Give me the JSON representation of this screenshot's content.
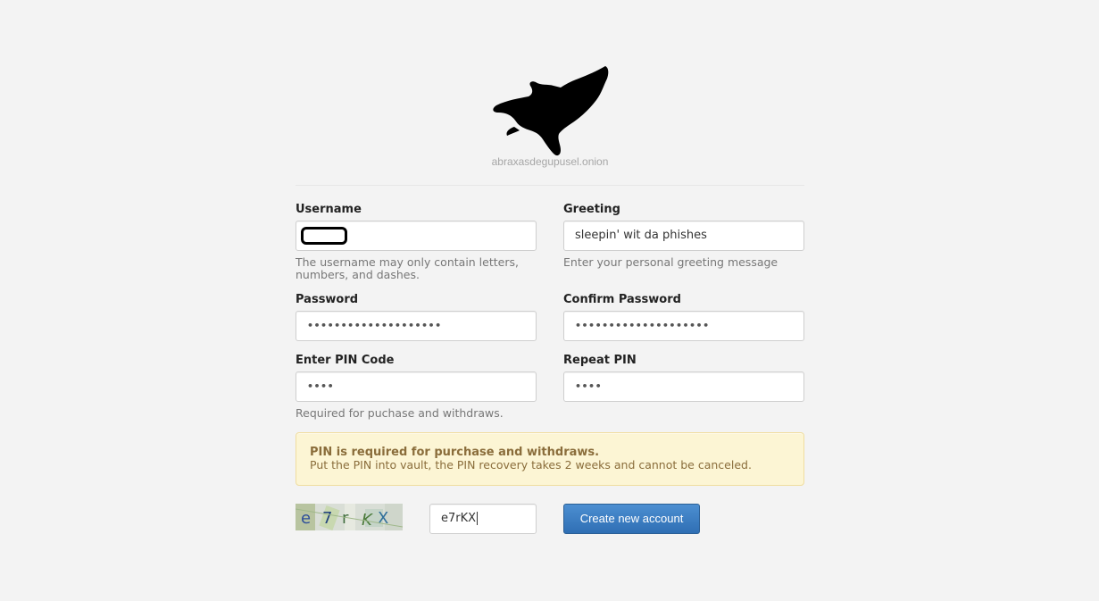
{
  "header": {
    "site_name": "abraxasdegupusel.onion",
    "logo_icon": "eagle-icon"
  },
  "form": {
    "username": {
      "label": "Username",
      "value": "",
      "help": "The username may only contain letters, numbers, and dashes."
    },
    "greeting": {
      "label": "Greeting",
      "value": "sleepin' wit da phishes",
      "help": "Enter your personal greeting message"
    },
    "password": {
      "label": "Password",
      "value": "••••••••••••••••••••"
    },
    "confirm_password": {
      "label": "Confirm Password",
      "value": "••••••••••••••••••••"
    },
    "pin": {
      "label": "Enter PIN Code",
      "value": "••••",
      "help": "Required for puchase and withdraws."
    },
    "repeat_pin": {
      "label": "Repeat PIN",
      "value": "••••"
    }
  },
  "alert": {
    "title": "PIN is required for purchase and withdraws.",
    "body": "Put the PIN into vault, the PIN recovery takes 2 weeks and cannot be canceled."
  },
  "captcha": {
    "image_text": "e7rKX",
    "input_value": "e7rKX"
  },
  "submit": {
    "label": "Create new account"
  },
  "colors": {
    "background": "#f3f3f3",
    "primary_button": "#3a7bc2",
    "alert_background": "#fcf5d4",
    "alert_text": "#8a6d3b"
  }
}
